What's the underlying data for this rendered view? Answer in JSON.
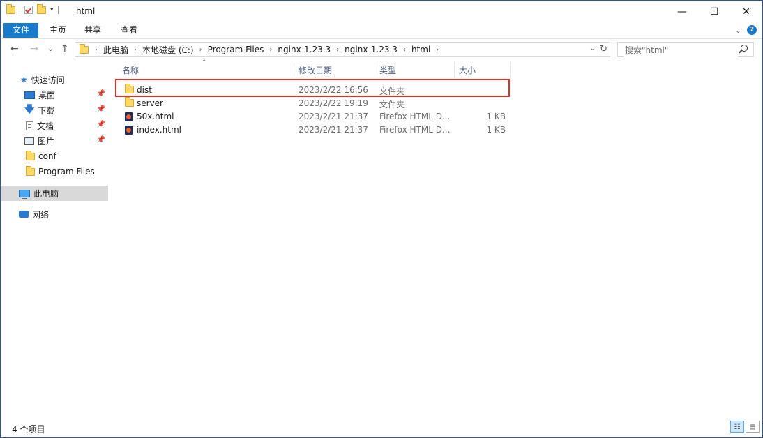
{
  "window": {
    "title": "html",
    "controls": {
      "minimize": "—",
      "maximize": "☐",
      "close": "✕"
    }
  },
  "ribbon": {
    "tabs": [
      "文件",
      "主页",
      "共享",
      "查看"
    ],
    "help": "?"
  },
  "navigation": {
    "back": "←",
    "forward": "→",
    "recent": "⌄",
    "up": "↑"
  },
  "address": {
    "crumbs": [
      "此电脑",
      "本地磁盘 (C:)",
      "Program Files",
      "nginx-1.23.3",
      "nginx-1.23.3",
      "html"
    ]
  },
  "search": {
    "placeholder": "搜索\"html\""
  },
  "sidebar": {
    "quick_access": "快速访问",
    "items": [
      {
        "label": "桌面",
        "icon": "desktop-icon",
        "pinned": true
      },
      {
        "label": "下载",
        "icon": "download-icon",
        "pinned": true
      },
      {
        "label": "文档",
        "icon": "document-icon",
        "pinned": true
      },
      {
        "label": "图片",
        "icon": "pictures-icon",
        "pinned": true
      },
      {
        "label": "conf",
        "icon": "folder-icon",
        "pinned": false
      },
      {
        "label": "Program Files",
        "icon": "folder-icon",
        "pinned": false
      }
    ],
    "this_pc": "此电脑",
    "network": "网络"
  },
  "columns": {
    "name": "名称",
    "date": "修改日期",
    "type": "类型",
    "size": "大小"
  },
  "files": [
    {
      "name": "dist",
      "date": "2023/2/22 16:56",
      "type": "文件夹",
      "size": "",
      "icon": "folder-icon",
      "highlighted": true
    },
    {
      "name": "server",
      "date": "2023/2/22 19:19",
      "type": "文件夹",
      "size": "",
      "icon": "folder-icon",
      "highlighted": false
    },
    {
      "name": "50x.html",
      "date": "2023/2/21 21:37",
      "type": "Firefox HTML D...",
      "size": "1 KB",
      "icon": "firefox-html-file-icon",
      "highlighted": false
    },
    {
      "name": "index.html",
      "date": "2023/2/21 21:37",
      "type": "Firefox HTML D...",
      "size": "1 KB",
      "icon": "firefox-html-file-icon",
      "highlighted": false
    }
  ],
  "status": {
    "item_count": "4 个项目"
  },
  "colors": {
    "accent": "#1979ca",
    "highlight_border": "#d9352b",
    "folder": "#ffd966"
  }
}
